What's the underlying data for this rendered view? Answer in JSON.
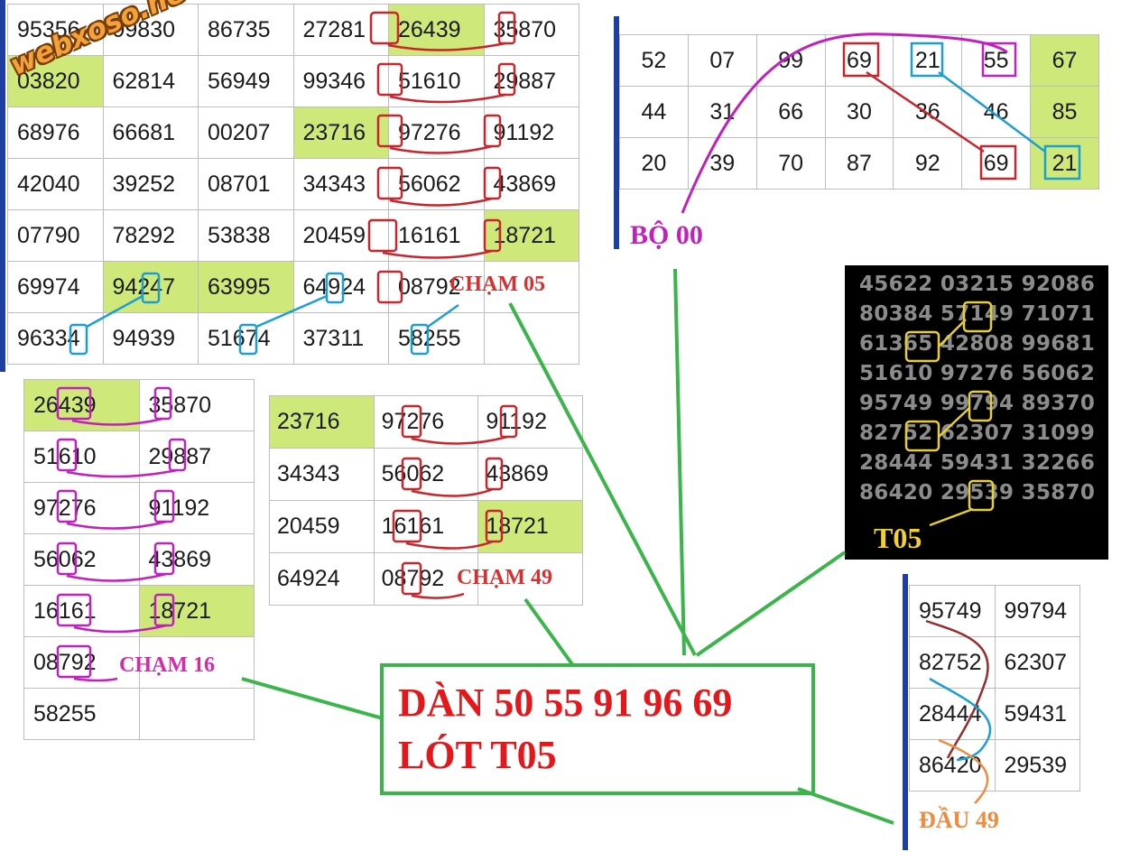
{
  "watermark": "webxoso.net",
  "table_a": {
    "rows": [
      [
        "95356",
        "99830",
        "86735",
        "27281",
        "26439",
        "35870"
      ],
      [
        "03820",
        "62814",
        "56949",
        "99346",
        "51610",
        "29887"
      ],
      [
        "68976",
        "66681",
        "00207",
        "23716",
        "97276",
        "91192"
      ],
      [
        "42040",
        "39252",
        "08701",
        "34343",
        "56062",
        "43869"
      ],
      [
        "07790",
        "78292",
        "53838",
        "20459",
        "16161",
        "18721"
      ],
      [
        "69974",
        "94247",
        "63995",
        "64924",
        "08792",
        ""
      ],
      [
        "96334",
        "94939",
        "51674",
        "37311",
        "58255",
        ""
      ]
    ],
    "label": "CHẠM 05"
  },
  "table_b": {
    "rows": [
      [
        "52",
        "07",
        "99",
        "69",
        "21",
        "55",
        "67"
      ],
      [
        "44",
        "31",
        "66",
        "30",
        "36",
        "46",
        "85"
      ],
      [
        "20",
        "39",
        "70",
        "87",
        "92",
        "69",
        "21"
      ]
    ],
    "label": "BỘ 00"
  },
  "black_panel": {
    "rows": [
      "45622 03215 92086",
      "80384 57149 71071",
      "61365 42808 99681",
      "51610 97276 56062",
      "95749 99794 89370",
      "82752 62307 31099",
      "28444 59431 32266",
      "86420 29539 35870"
    ],
    "label": "T05"
  },
  "table_c": {
    "rows": [
      [
        "26439",
        "35870"
      ],
      [
        "51610",
        "29887"
      ],
      [
        "97276",
        "91192"
      ],
      [
        "56062",
        "43869"
      ],
      [
        "16161",
        "18721"
      ],
      [
        "08792",
        ""
      ],
      [
        "58255",
        ""
      ]
    ],
    "label": "CHẠM 16"
  },
  "table_d": {
    "rows": [
      [
        "23716",
        "97276",
        "91192"
      ],
      [
        "34343",
        "56062",
        "43869"
      ],
      [
        "20459",
        "16161",
        "18721"
      ],
      [
        "64924",
        "08792",
        ""
      ]
    ],
    "label": "CHẠM 49"
  },
  "table_e": {
    "rows": [
      [
        "95749",
        "99794"
      ],
      [
        "82752",
        "62307"
      ],
      [
        "28444",
        "59431"
      ],
      [
        "86420",
        "29539"
      ]
    ],
    "label": "ĐẦU 49"
  },
  "main_box": {
    "line1": "DÀN 50 55 91 96 69",
    "line2": "LÓT T05"
  },
  "colors": {
    "cell_highlight": "#cfe87a",
    "box_red": "#c9252c",
    "box_blue": "#1a9fd4",
    "box_magenta": "#c21fbf",
    "box_yellow": "#e8cf2c",
    "connector_green": "#3ab54a",
    "label_red": "#d7302f",
    "label_magenta": "#d62aa8",
    "label_orange": "#f08a3c",
    "main_text_red": "#e5171b"
  }
}
